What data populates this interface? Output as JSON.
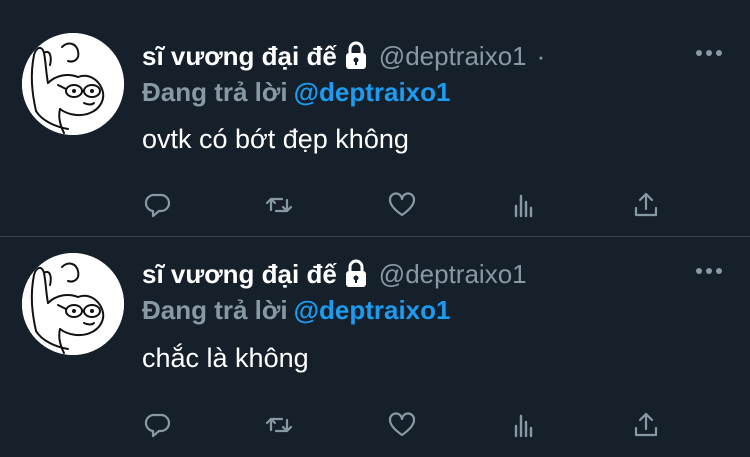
{
  "tweets": [
    {
      "display_name": "sĩ vương đại đế",
      "handle": "@deptraixo1",
      "separator": "·",
      "reply_label": "Đang trả lời",
      "reply_to": "@deptraixo1",
      "text": "ovtk có bớt đẹp không"
    },
    {
      "display_name": "sĩ vương đại đế",
      "handle": "@deptraixo1",
      "separator": "",
      "reply_label": "Đang trả lời",
      "reply_to": "@deptraixo1",
      "text": "chắc là không"
    }
  ],
  "icons": {
    "avatar": "avatar-drawing",
    "lock": "lock-icon",
    "more": "more-icon",
    "reply": "reply-icon",
    "retweet": "retweet-icon",
    "like": "heart-icon",
    "stats": "analytics-icon",
    "share": "share-icon"
  },
  "colors": {
    "background": "#15202b",
    "divider": "#38444d",
    "secondary_text": "#8899a6",
    "link": "#1d9bf0",
    "primary_text": "#ffffff"
  }
}
